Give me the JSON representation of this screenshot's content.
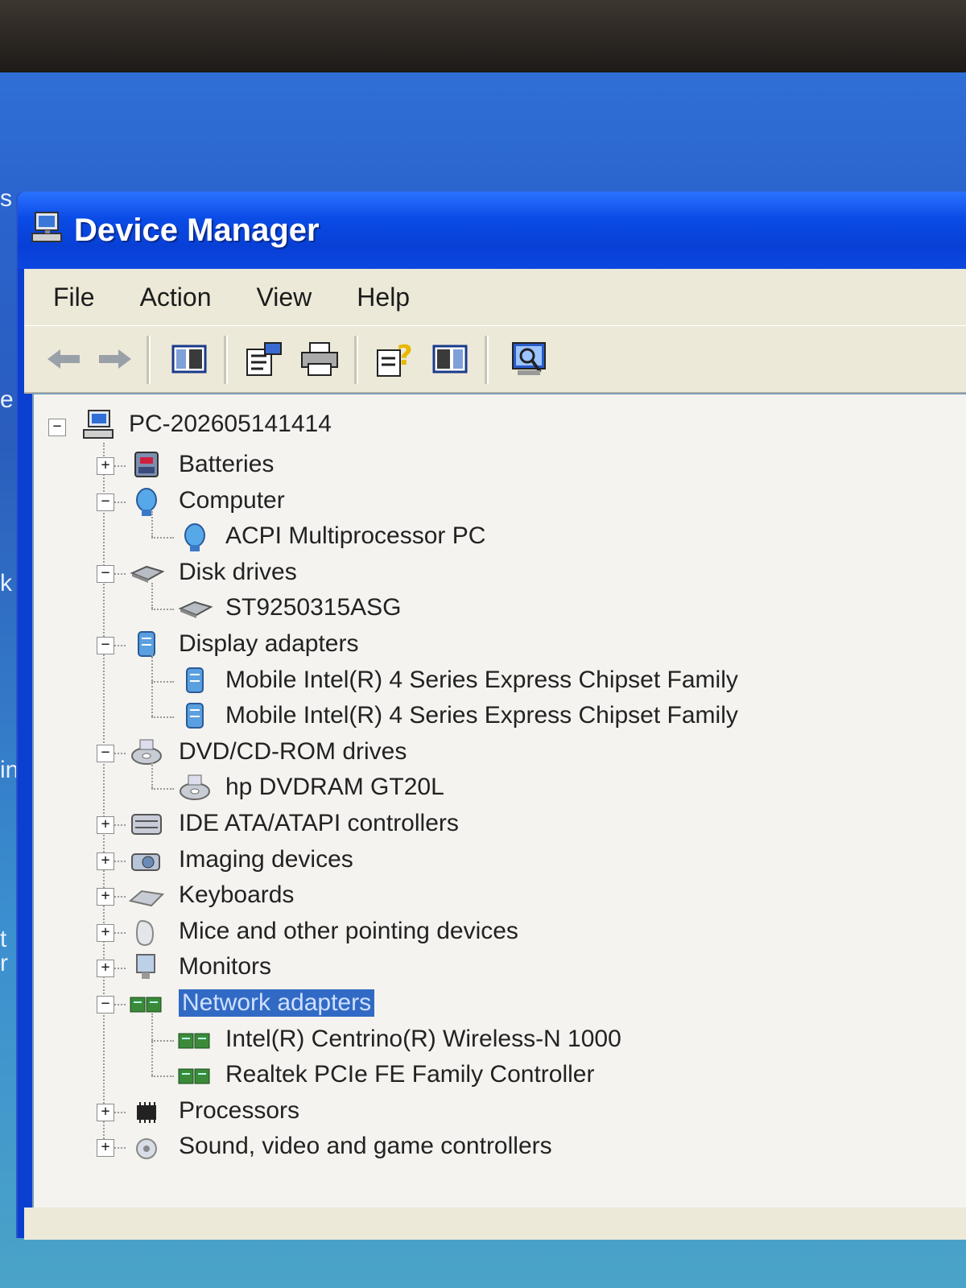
{
  "window": {
    "title": "Device Manager"
  },
  "menu": {
    "file": "File",
    "action": "Action",
    "view": "View",
    "help": "Help"
  },
  "toolbar": {
    "buttons": [
      "back-icon",
      "forward-icon",
      "show-hide-tree-icon",
      "properties-icon",
      "print-icon",
      "help-icon",
      "show-hide-action-pane-icon",
      "scan-hardware-icon"
    ]
  },
  "tree": {
    "root": "PC-202605141414",
    "nodes": [
      {
        "label": "Batteries",
        "expander": "+",
        "icon": "battery-icon"
      },
      {
        "label": "Computer",
        "expander": "−",
        "icon": "computer-icon"
      },
      {
        "label": "ACPI Multiprocessor PC",
        "expander": "",
        "icon": "computer-icon"
      },
      {
        "label": "Disk drives",
        "expander": "−",
        "icon": "disk-drive-icon"
      },
      {
        "label": "ST9250315ASG",
        "expander": "",
        "icon": "disk-drive-icon"
      },
      {
        "label": "Display adapters",
        "expander": "−",
        "icon": "display-adapter-icon"
      },
      {
        "label": "Mobile Intel(R) 4 Series Express Chipset Family",
        "expander": "",
        "icon": "display-adapter-icon"
      },
      {
        "label": "Mobile Intel(R) 4 Series Express Chipset Family",
        "expander": "",
        "icon": "display-adapter-icon"
      },
      {
        "label": "DVD/CD-ROM drives",
        "expander": "−",
        "icon": "cdrom-icon"
      },
      {
        "label": "hp DVDRAM GT20L",
        "expander": "",
        "icon": "cdrom-icon"
      },
      {
        "label": "IDE ATA/ATAPI controllers",
        "expander": "+",
        "icon": "ide-controller-icon"
      },
      {
        "label": "Imaging devices",
        "expander": "+",
        "icon": "camera-icon"
      },
      {
        "label": "Keyboards",
        "expander": "+",
        "icon": "keyboard-icon"
      },
      {
        "label": "Mice and other pointing devices",
        "expander": "+",
        "icon": "mouse-icon"
      },
      {
        "label": "Monitors",
        "expander": "+",
        "icon": "monitor-icon"
      },
      {
        "label": "Network adapters",
        "expander": "−",
        "icon": "network-adapter-icon",
        "selected": true
      },
      {
        "label": "Intel(R) Centrino(R) Wireless-N 1000",
        "expander": "",
        "icon": "network-adapter-icon"
      },
      {
        "label": "Realtek PCIe FE Family Controller",
        "expander": "",
        "icon": "network-adapter-icon"
      },
      {
        "label": "Processors",
        "expander": "+",
        "icon": "processor-icon"
      },
      {
        "label": "Sound, video and game controllers",
        "expander": "+",
        "icon": "sound-icon"
      }
    ]
  },
  "desktop": {
    "letters": [
      "s",
      "e",
      "k",
      "in",
      "t",
      "r"
    ]
  },
  "colors": {
    "titlebar": "#0a4be6",
    "selection": "#316ac5",
    "chrome": "#ece9d8"
  }
}
